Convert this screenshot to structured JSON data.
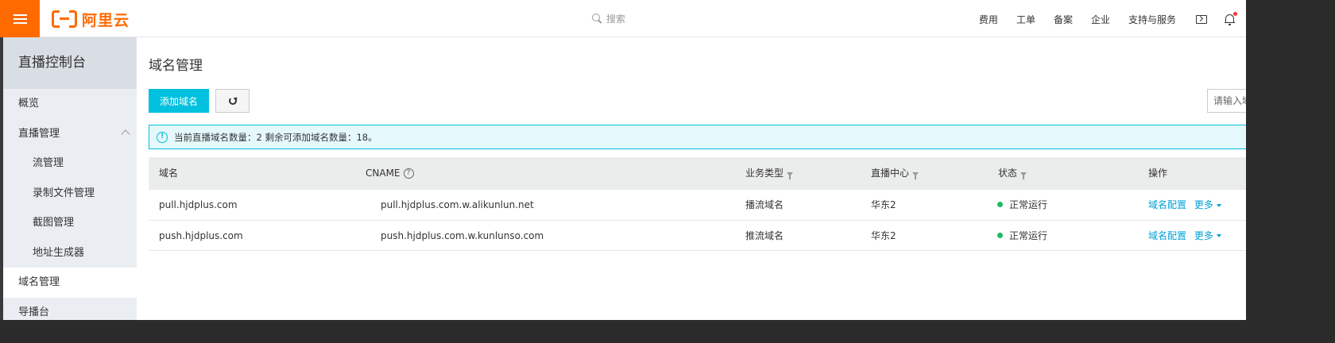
{
  "topbar": {
    "logo_text": "阿里云",
    "search_placeholder": "搜索",
    "nav": [
      "费用",
      "工单",
      "备案",
      "企业",
      "支持与服务"
    ],
    "brand_color": "#ff6a00"
  },
  "sidebar": {
    "title": "直播控制台",
    "items": [
      {
        "label": "概览"
      },
      {
        "label": "直播管理"
      },
      {
        "label": "流管理"
      },
      {
        "label": "录制文件管理"
      },
      {
        "label": "截图管理"
      },
      {
        "label": "地址生成器"
      },
      {
        "label": "域名管理"
      },
      {
        "label": "导播台"
      }
    ]
  },
  "main": {
    "title": "域名管理",
    "add_button": "添加域名",
    "search_placeholder": "请输入域名",
    "notice": "当前直播域名数量：2 剩余可添加域名数量：18。",
    "columns": {
      "domain": "域名",
      "cname": "CNAME",
      "type": "业务类型",
      "center": "直播中心",
      "status": "状态",
      "actions": "操作"
    },
    "rows": [
      {
        "domain": "pull.hjdplus.com",
        "cname": "pull.hjdplus.com.w.alikunlun.net",
        "type": "播流域名",
        "center": "华东2",
        "status": "正常运行",
        "config": "域名配置",
        "more": "更多"
      },
      {
        "domain": "push.hjdplus.com",
        "cname": "push.hjdplus.com.w.kunlunso.com",
        "type": "推流域名",
        "center": "华东2",
        "status": "正常运行",
        "config": "域名配置",
        "more": "更多"
      }
    ],
    "accent_color": "#00c1de",
    "status_color": "#1ebc62"
  }
}
